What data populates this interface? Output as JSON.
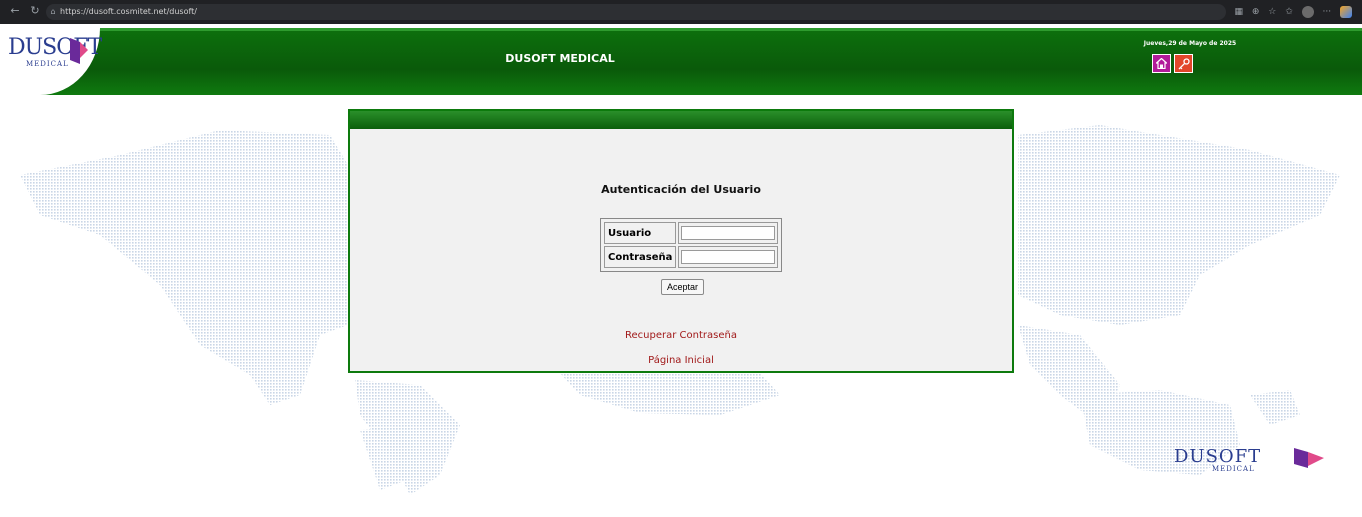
{
  "browser": {
    "url": "https://dusoft.cosmitet.net/dusoft/"
  },
  "header": {
    "logo_text": "DUSOFT",
    "logo_sub": "MEDICAL",
    "title": "DUSOFT MEDICAL",
    "date": "Jueves,29 de Mayo de 2025"
  },
  "login": {
    "title": "Autenticación del Usuario",
    "username_label": "Usuario",
    "password_label": "Contraseña",
    "username_value": "",
    "password_value": "",
    "submit_label": "Aceptar",
    "recover_link": "Recuperar Contraseña",
    "home_link": "Página Inicial"
  },
  "footer_brand": {
    "text": "DUSOFT",
    "sub": "MEDICAL"
  },
  "colors": {
    "header_green": "#0a5a0a",
    "panel_border": "#0d7a0d",
    "link_red": "#a11a1a",
    "home_button": "#b11c9a",
    "key_button": "#e2462b",
    "logo_blue": "#2a3d8f",
    "map_dots": "#c9d6e6"
  },
  "icons": {
    "home": "home-icon",
    "key": "key-icon",
    "lock": "lock-icon"
  }
}
